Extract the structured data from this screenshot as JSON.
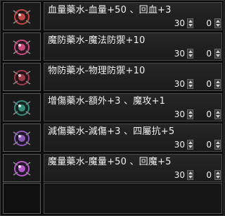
{
  "items": [
    {
      "name": "血量藥水-血量+50 、回血+3",
      "qty": "30",
      "count": "0",
      "icon": "red-orb-potion-icon",
      "color": "#c04848"
    },
    {
      "name": "魔防藥水-魔法防禦+10",
      "qty": "30",
      "count": "0",
      "icon": "pink-orb-potion-icon",
      "color": "#c84a7a"
    },
    {
      "name": "物防藥水-物理防禦+10",
      "qty": "30",
      "count": "0",
      "icon": "maroon-orb-potion-icon",
      "color": "#9a3a4a"
    },
    {
      "name": "增傷藥水-額外+3 、魔攻+1",
      "qty": "30",
      "count": "0",
      "icon": "teal-orb-potion-icon",
      "color": "#3a8a7a"
    },
    {
      "name": "減傷藥水-減傷+3 、四屬抗+5",
      "qty": "30",
      "count": "0",
      "icon": "purple-orb-potion-icon",
      "color": "#8a5ab4"
    },
    {
      "name": "魔量藥水-魔量+50 、回魔+5",
      "qty": "30",
      "count": "0",
      "icon": "violet-orb-potion-icon",
      "color": "#b45ac8"
    }
  ]
}
